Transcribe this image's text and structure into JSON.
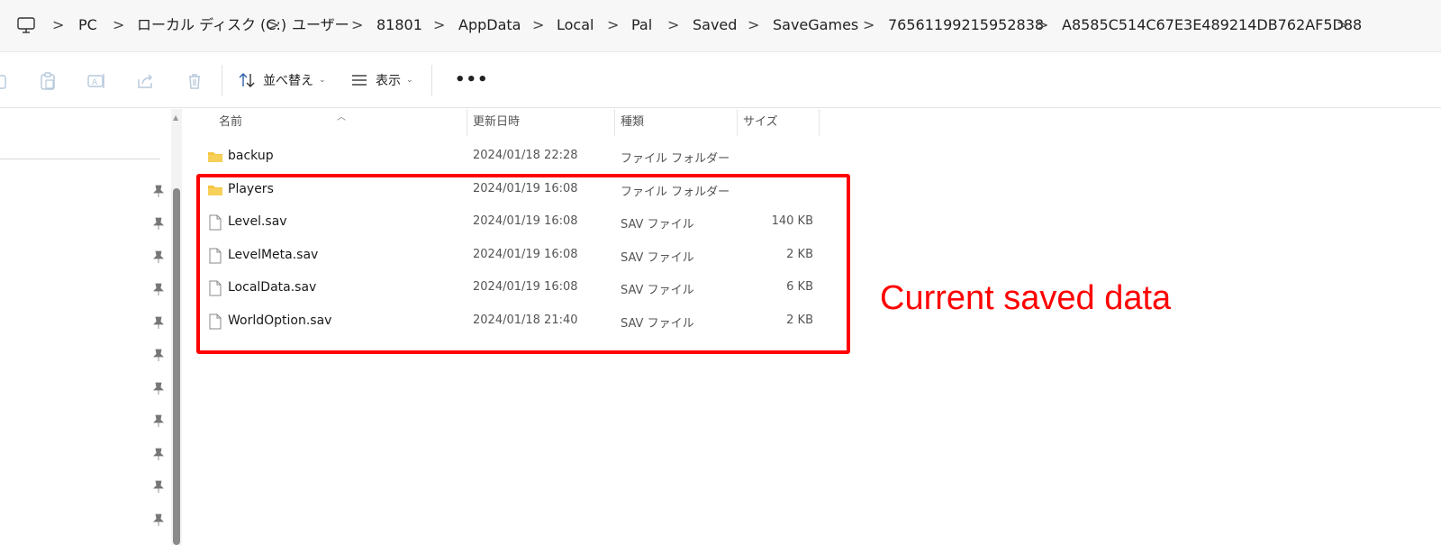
{
  "address_bar": {
    "crumbs": [
      "PC",
      "ローカル ディスク (C:)",
      "ユーザー",
      "81801",
      "AppData",
      "Local",
      "Pal",
      "Saved",
      "SaveGames",
      "76561199215952838",
      "A8585C514C67E3E489214DB762AF5D88"
    ],
    "separator": ">"
  },
  "toolbar": {
    "icons": [
      "copy-icon",
      "paste-icon",
      "rename-icon",
      "share-icon",
      "delete-icon"
    ],
    "sort_label": "並べ替え",
    "view_label": "表示",
    "caret": "⌄",
    "more_label": "•••"
  },
  "columns": {
    "name": "名前",
    "modified": "更新日時",
    "type": "種類",
    "size": "サイズ"
  },
  "files": [
    {
      "icon": "folder-icon",
      "name": "backup",
      "modified": "2024/01/18 22:28",
      "type": "ファイル フォルダー",
      "size": ""
    },
    {
      "icon": "folder-icon",
      "name": "Players",
      "modified": "2024/01/19 16:08",
      "type": "ファイル フォルダー",
      "size": ""
    },
    {
      "icon": "file-icon",
      "name": "Level.sav",
      "modified": "2024/01/19 16:08",
      "type": "SAV ファイル",
      "size": "140 KB"
    },
    {
      "icon": "file-icon",
      "name": "LevelMeta.sav",
      "modified": "2024/01/19 16:08",
      "type": "SAV ファイル",
      "size": "2 KB"
    },
    {
      "icon": "file-icon",
      "name": "LocalData.sav",
      "modified": "2024/01/19 16:08",
      "type": "SAV ファイル",
      "size": "6 KB"
    },
    {
      "icon": "file-icon",
      "name": "WorldOption.sav",
      "modified": "2024/01/18 21:40",
      "type": "SAV ファイル",
      "size": "2 KB"
    }
  ],
  "annotation": {
    "text": "Current saved data",
    "color": "#ff0000"
  },
  "colors": {
    "folder": "#f4c542",
    "highlight": "#ff0000"
  }
}
